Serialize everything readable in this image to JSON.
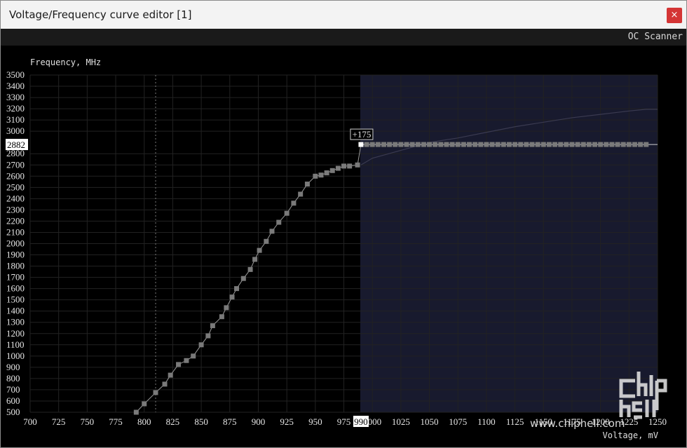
{
  "window": {
    "title": "Voltage/Frequency curve editor [1]",
    "close_glyph": "×"
  },
  "toolbar": {
    "oc_scanner_label": "OC Scanner"
  },
  "chart_data": {
    "type": "line",
    "ylabel": "Frequency, MHz",
    "xlabel": "Voltage, mV",
    "xlim": [
      700,
      1250
    ],
    "ylim": [
      500,
      3500
    ],
    "x_ticks": [
      700,
      725,
      750,
      775,
      800,
      825,
      850,
      875,
      900,
      925,
      950,
      975,
      1000,
      1025,
      1050,
      1075,
      1100,
      1125,
      1150,
      1175,
      1200,
      1225,
      1250
    ],
    "y_ticks": [
      500,
      600,
      700,
      800,
      900,
      1000,
      1100,
      1200,
      1300,
      1400,
      1500,
      1600,
      1700,
      1800,
      1900,
      2000,
      2100,
      2200,
      2300,
      2400,
      2500,
      2600,
      2700,
      2800,
      3000,
      3100,
      3200,
      3300,
      3400,
      3500
    ],
    "grid": true,
    "locked_voltage_label": "990",
    "locked_frequency_label": "2882",
    "offset_label": "+175",
    "dotted_marker_voltage": 810,
    "series": [
      {
        "role": "edited curve",
        "color": "#7a7a7a",
        "points": [
          [
            793,
            500
          ],
          [
            800,
            575
          ],
          [
            810,
            675
          ],
          [
            818,
            750
          ],
          [
            823,
            830
          ],
          [
            830,
            925
          ],
          [
            837,
            960
          ],
          [
            843,
            1000
          ],
          [
            850,
            1100
          ],
          [
            856,
            1180
          ],
          [
            860,
            1270
          ],
          [
            868,
            1350
          ],
          [
            872,
            1430
          ],
          [
            877,
            1525
          ],
          [
            881,
            1600
          ],
          [
            887,
            1690
          ],
          [
            893,
            1770
          ],
          [
            897,
            1860
          ],
          [
            901,
            1940
          ],
          [
            907,
            2020
          ],
          [
            912,
            2110
          ],
          [
            918,
            2190
          ],
          [
            925,
            2270
          ],
          [
            931,
            2360
          ],
          [
            937,
            2440
          ],
          [
            943,
            2530
          ],
          [
            950,
            2600
          ],
          [
            955,
            2610
          ],
          [
            960,
            2630
          ],
          [
            965,
            2650
          ],
          [
            970,
            2670
          ],
          [
            975,
            2690
          ],
          [
            980,
            2690
          ],
          [
            987,
            2700
          ],
          [
            990,
            2882
          ]
        ]
      },
      {
        "role": "flat section",
        "color": "#7a7a7a",
        "points": [
          [
            995,
            2882
          ],
          [
            1000,
            2882
          ],
          [
            1005,
            2882
          ],
          [
            1010,
            2882
          ],
          [
            1015,
            2882
          ],
          [
            1020,
            2882
          ],
          [
            1025,
            2882
          ],
          [
            1030,
            2882
          ],
          [
            1035,
            2882
          ],
          [
            1040,
            2882
          ],
          [
            1045,
            2882
          ],
          [
            1050,
            2882
          ],
          [
            1055,
            2882
          ],
          [
            1060,
            2882
          ],
          [
            1065,
            2882
          ],
          [
            1070,
            2882
          ],
          [
            1075,
            2882
          ],
          [
            1080,
            2882
          ],
          [
            1085,
            2882
          ],
          [
            1090,
            2882
          ],
          [
            1095,
            2882
          ],
          [
            1100,
            2882
          ],
          [
            1105,
            2882
          ],
          [
            1110,
            2882
          ],
          [
            1115,
            2882
          ],
          [
            1120,
            2882
          ],
          [
            1125,
            2882
          ],
          [
            1130,
            2882
          ],
          [
            1135,
            2882
          ],
          [
            1140,
            2882
          ],
          [
            1145,
            2882
          ],
          [
            1150,
            2882
          ],
          [
            1155,
            2882
          ],
          [
            1160,
            2882
          ],
          [
            1165,
            2882
          ],
          [
            1170,
            2882
          ],
          [
            1175,
            2882
          ],
          [
            1180,
            2882
          ],
          [
            1185,
            2882
          ],
          [
            1190,
            2882
          ],
          [
            1195,
            2882
          ],
          [
            1200,
            2882
          ],
          [
            1205,
            2882
          ],
          [
            1210,
            2882
          ],
          [
            1215,
            2882
          ],
          [
            1220,
            2882
          ],
          [
            1225,
            2882
          ],
          [
            1230,
            2882
          ],
          [
            1235,
            2882
          ],
          [
            1240,
            2882
          ]
        ]
      },
      {
        "role": "original curve",
        "color": "#3a3a50",
        "points": [
          [
            990,
            2700
          ],
          [
            1000,
            2760
          ],
          [
            1025,
            2830
          ],
          [
            1050,
            2900
          ],
          [
            1075,
            2940
          ],
          [
            1100,
            2990
          ],
          [
            1125,
            3040
          ],
          [
            1150,
            3080
          ],
          [
            1175,
            3120
          ],
          [
            1200,
            3150
          ],
          [
            1225,
            3180
          ],
          [
            1240,
            3195
          ],
          [
            1250,
            3195
          ]
        ]
      }
    ]
  },
  "watermark": {
    "text": "www.chiphell.com",
    "logo_text": "chip hell"
  }
}
